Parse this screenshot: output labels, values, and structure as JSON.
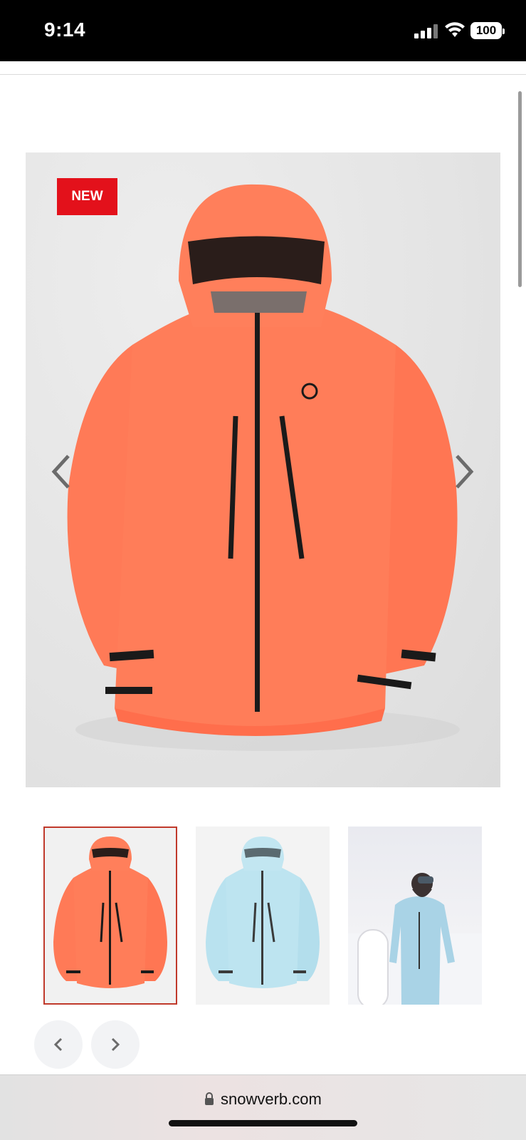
{
  "status_bar": {
    "time": "9:14",
    "battery": "100"
  },
  "product": {
    "badge": "NEW",
    "jacket_color": "#ff7a55",
    "trim_color": "#1a1a1a",
    "thumbnails": [
      {
        "name": "coral-jacket",
        "selected": true
      },
      {
        "name": "light-blue-jacket",
        "selected": false
      },
      {
        "name": "model-snowboard-photo",
        "selected": false
      }
    ]
  },
  "browser": {
    "url": "snowverb.com"
  },
  "colors": {
    "badge": "#e3111b",
    "selected_border": "#c0392b",
    "status_bg": "#000000"
  }
}
